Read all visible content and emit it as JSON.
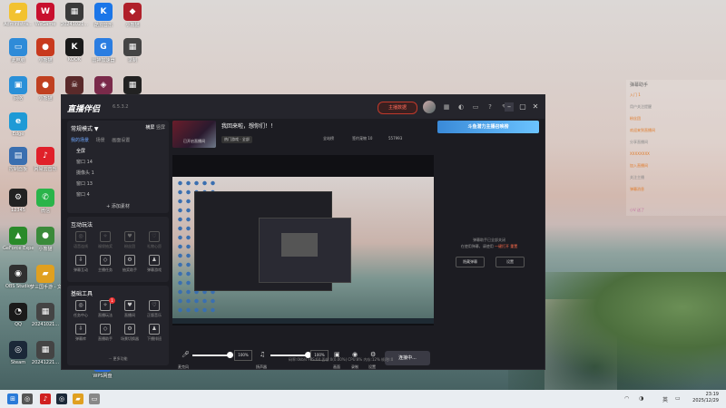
{
  "desktop": {
    "icons": [
      {
        "label": "Administra...",
        "color": "#f2c230",
        "glyph": "▰",
        "name": "folder-icon"
      },
      {
        "label": "WeGame",
        "color": "#c8102e",
        "glyph": "W",
        "name": "wegame-icon"
      },
      {
        "label": "20241021...",
        "color": "#3a3a3a",
        "glyph": "▦",
        "name": "video-file-icon"
      },
      {
        "label": "酷狗音乐",
        "color": "#1b76e8",
        "glyph": "K",
        "name": "kugou-icon"
      },
      {
        "label": "小熊猫",
        "color": "#b0202a",
        "glyph": "◆",
        "name": "game-icon"
      },
      {
        "label": "此电脑",
        "color": "#2e8bd8",
        "glyph": "▭",
        "name": "computer-icon"
      },
      {
        "label": "小熊猫",
        "color": "#c83a1e",
        "glyph": "●",
        "name": "app-icon"
      },
      {
        "label": "KOOK",
        "color": "#1a1a1a",
        "glyph": "K",
        "name": "kook-icon"
      },
      {
        "label": "雷神加速器",
        "color": "#2a7de1",
        "glyph": "G",
        "name": "accelerator-icon"
      },
      {
        "label": "录制",
        "color": "#444",
        "glyph": "▦",
        "name": "record-icon"
      },
      {
        "label": "网络",
        "color": "#2a90d8",
        "glyph": "▣",
        "name": "network-icon"
      },
      {
        "label": "小熊猫",
        "color": "#c04020",
        "glyph": "●",
        "name": "app2-icon"
      },
      {
        "label": "",
        "color": "#5a2a2a",
        "glyph": "☠",
        "name": "game2-icon"
      },
      {
        "label": "",
        "color": "#7a2a4a",
        "glyph": "◈",
        "name": "game3-icon"
      },
      {
        "label": "",
        "color": "#222",
        "glyph": "▦",
        "name": "video2-icon"
      },
      {
        "label": "Edge",
        "color": "#1e9ad6",
        "glyph": "e",
        "name": "edge-icon"
      },
      {
        "label": "控制面板",
        "color": "#3a6fb0",
        "glyph": "▤",
        "name": "control-panel-icon"
      },
      {
        "label": "网易云音乐",
        "color": "#e0202a",
        "glyph": "♪",
        "name": "netease-music-icon"
      },
      {
        "label": "12345",
        "color": "#222",
        "glyph": "⚙",
        "name": "settings-app-icon"
      },
      {
        "label": "微信",
        "color": "#2ab44a",
        "glyph": "✆",
        "name": "wechat-icon"
      },
      {
        "label": "GeForce Experience",
        "color": "#2a8a2a",
        "glyph": "▲",
        "name": "nvidia-icon"
      },
      {
        "label": "小熊猫",
        "color": "#3a8a3a",
        "glyph": "●",
        "name": "app3-icon"
      },
      {
        "label": "OBS Studio",
        "color": "#303030",
        "glyph": "◉",
        "name": "obs-icon"
      },
      {
        "label": "梦三国手游 - 文件",
        "color": "#e0a020",
        "glyph": "▰",
        "name": "folder2-icon"
      },
      {
        "label": "QQ",
        "color": "#1a1a1a",
        "glyph": "◔",
        "name": "qq-icon"
      },
      {
        "label": "20241021...",
        "color": "#444",
        "glyph": "▦",
        "name": "video3-icon"
      },
      {
        "label": "Steam",
        "color": "#1b2838",
        "glyph": "◎",
        "name": "steam-icon"
      },
      {
        "label": "20241221...",
        "color": "#444",
        "glyph": "▦",
        "name": "video4-icon"
      },
      {
        "label": "WPS网盘",
        "color": "#2a6ad8",
        "glyph": "▣",
        "name": "wps-icon"
      }
    ]
  },
  "app": {
    "logo": "直播伴侣",
    "version": "6.5.3.2",
    "live_button": "主播数据",
    "main_mode": "常规模式 ▼",
    "mode_right_a": "横屏",
    "mode_right_b": "竖屏",
    "tabs": [
      "我的场景",
      "场景",
      "画面设置"
    ],
    "scenes": [
      "全屏",
      "窗口 14",
      "摄像头 1",
      "窗口 13",
      "窗口 4"
    ],
    "add_material": "+ 添加素材",
    "interactive_title": "互动玩法",
    "interactive": [
      "语音连线",
      "福袋抽奖",
      "粉丝团",
      "礼物心愿",
      "弹幕互动",
      "主播任务",
      "抽奖助手",
      "弹幕游戏"
    ],
    "tools_title": "基础工具",
    "tools": [
      "任务中心",
      "直播玩法",
      "直播间",
      "正版音乐",
      "弹幕库",
      "直播助手",
      "场景切换器",
      "下播排班"
    ],
    "tools_badge": "1",
    "more_features": "··· 更多功能",
    "room_thumb_label": "已开启直播间",
    "room_title": "我回来啦，想你们！！",
    "room_category": "热门游戏 · 全部",
    "stats": [
      "全站榜",
      "签约宠物 10",
      "557993",
      "分享"
    ],
    "controls": {
      "mic_label": "麦克风",
      "mic_pct": "100%",
      "speaker_label": "扬声器",
      "speaker_pct": "100%",
      "camera_label": "画面",
      "record_label": "录制",
      "settings_label": "设置",
      "connect_button": "连接中..."
    },
    "status_bar": "码率:0kb/s   FPS:60   丢帧:0(0.00%)   CPU:8%   内存:12%   帧/秒:0",
    "banner": "斗鱼潜力主播召唤榜",
    "chat_empty_line1": "弹幕助手已全部关闭",
    "chat_empty_line2": "在使用弹幕，请使用",
    "chat_empty_link1": "一键打开",
    "chat_empty_link2": "重置",
    "chat_btn_a": "隐藏弹幕",
    "chat_btn_b": "设置"
  },
  "overlay": {
    "title": "弹幕助手",
    "lines": [
      "入门 1",
      "用户关注提醒",
      "粉丝团",
      "欢迎来到直播间",
      "分享直播间",
      "XXXXXXXX",
      "加入直播间",
      "关注主播",
      "弹幕消息"
    ],
    "tag": "小V 送了"
  },
  "taskbar": {
    "clock_time": "23:19",
    "clock_date": "2025/12/29",
    "lang": "英",
    "items": [
      {
        "name": "windows-start-icon",
        "color": "#2a7ad8",
        "glyph": "⊞"
      },
      {
        "name": "search-icon",
        "color": "#555",
        "glyph": "◎"
      },
      {
        "name": "netease-taskbar-icon",
        "color": "#d02020",
        "glyph": "♪"
      },
      {
        "name": "steam-taskbar-icon",
        "color": "#1b2838",
        "glyph": "◎"
      },
      {
        "name": "file-explorer-icon",
        "color": "#e0a020",
        "glyph": "▰"
      },
      {
        "name": "app-taskbar-icon",
        "color": "#888",
        "glyph": "▭"
      }
    ]
  }
}
